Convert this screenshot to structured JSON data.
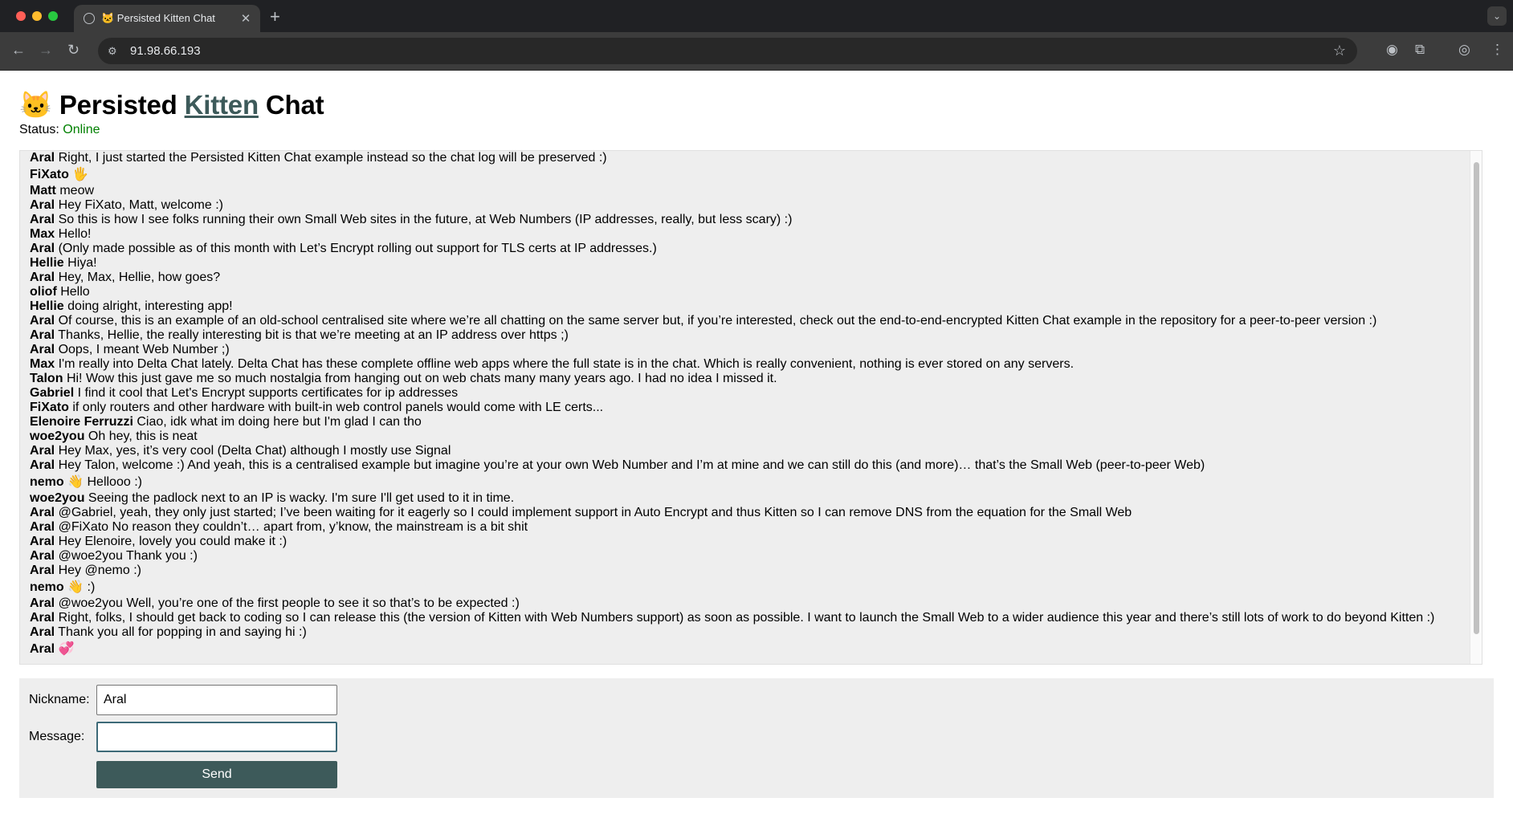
{
  "browser": {
    "tab_title": "🐱 Persisted Kitten Chat",
    "url": "91.98.66.193"
  },
  "page": {
    "title_emoji": "🐱",
    "title_pre": "Persisted",
    "title_link": "Kitten",
    "title_post": "Chat",
    "status_label": "Status:",
    "status_value": "Online"
  },
  "messages": [
    {
      "nick": "Aral",
      "text": "Right, I just started the Persisted Kitten Chat example instead so the chat log will be preserved :)"
    },
    {
      "nick": "FiXato",
      "text": "🖐️"
    },
    {
      "nick": "Matt",
      "text": "meow"
    },
    {
      "nick": "Aral",
      "text": "Hey FiXato, Matt, welcome :)"
    },
    {
      "nick": "Aral",
      "text": "So this is how I see folks running their own Small Web sites in the future, at Web Numbers (IP addresses, really, but less scary) :)"
    },
    {
      "nick": "Max",
      "text": "Hello!"
    },
    {
      "nick": "Aral",
      "text": "(Only made possible as of this month with Let’s Encrypt rolling out support for TLS certs at IP addresses.)"
    },
    {
      "nick": "Hellie",
      "text": "Hiya!"
    },
    {
      "nick": "Aral",
      "text": "Hey, Max, Hellie, how goes?"
    },
    {
      "nick": "oliof",
      "text": "Hello"
    },
    {
      "nick": "Hellie",
      "text": "doing alright, interesting app!"
    },
    {
      "nick": "Aral",
      "text": "Of course, this is an example of an old-school centralised site where we’re all chatting on the same server but, if you’re interested, check out the end-to-end-encrypted Kitten Chat example in the repository for a peer-to-peer version :)"
    },
    {
      "nick": "Aral",
      "text": "Thanks, Hellie, the really interesting bit is that we’re meeting at an IP address over https ;)"
    },
    {
      "nick": "Aral",
      "text": "Oops, I meant Web Number ;)"
    },
    {
      "nick": "Max",
      "text": "I'm really into Delta Chat lately. Delta Chat has these complete offline web apps where the full state is in the chat. Which is really convenient, nothing is ever stored on any servers."
    },
    {
      "nick": "Talon",
      "text": "Hi! Wow this just gave me so much nostalgia from hanging out on web chats many many years ago. I had no idea I missed it."
    },
    {
      "nick": "Gabriel",
      "text": "I find it cool that Let's Encrypt supports certificates for ip addresses"
    },
    {
      "nick": "FiXato",
      "text": "if only routers and other hardware with built-in web control panels would come with LE certs..."
    },
    {
      "nick": "Elenoire Ferruzzi",
      "text": "Ciao, idk what im doing here but I'm glad I can tho"
    },
    {
      "nick": "woe2you",
      "text": "Oh hey, this is neat"
    },
    {
      "nick": "Aral",
      "text": "Hey Max, yes, it’s very cool (Delta Chat) although I mostly use Signal"
    },
    {
      "nick": "Aral",
      "text": "Hey Talon, welcome :) And yeah, this is a centralised example but imagine you’re at your own Web Number and I’m at mine and we can still do this (and more)… that’s the Small Web (peer-to-peer Web)"
    },
    {
      "nick": "nemo",
      "text": "👋 Hellooo :)"
    },
    {
      "nick": "woe2you",
      "text": "Seeing the padlock next to an IP is wacky. I'm sure I'll get used to it in time."
    },
    {
      "nick": "Aral",
      "text": "@Gabriel, yeah, they only just started; I’ve been waiting for it eagerly so I could implement support in Auto Encrypt and thus Kitten so I can remove DNS from the equation for the Small Web"
    },
    {
      "nick": "Aral",
      "text": "@FiXato No reason they couldn’t… apart from, y’know, the mainstream is a bit shit"
    },
    {
      "nick": "Aral",
      "text": "Hey Elenoire, lovely you could make it :)"
    },
    {
      "nick": "Aral",
      "text": "@woe2you Thank you :)"
    },
    {
      "nick": "Aral",
      "text": "Hey @nemo :)"
    },
    {
      "nick": "nemo",
      "text": "👋 :)"
    },
    {
      "nick": "Aral",
      "text": "@woe2you Well, you’re one of the first people to see it so that’s to be expected :)"
    },
    {
      "nick": "Aral",
      "text": "Right, folks, I should get back to coding so I can release this (the version of Kitten with Web Numbers support) as soon as possible. I want to launch the Small Web to a wider audience this year and there’s still lots of work to do beyond Kitten :)"
    },
    {
      "nick": "Aral",
      "text": "Thank you all for popping in and saying hi :)"
    },
    {
      "nick": "Aral",
      "text": "💞"
    }
  ],
  "form": {
    "nickname_label": "Nickname:",
    "nickname_value": "Aral",
    "message_label": "Message:",
    "message_value": "",
    "send_label": "Send"
  }
}
